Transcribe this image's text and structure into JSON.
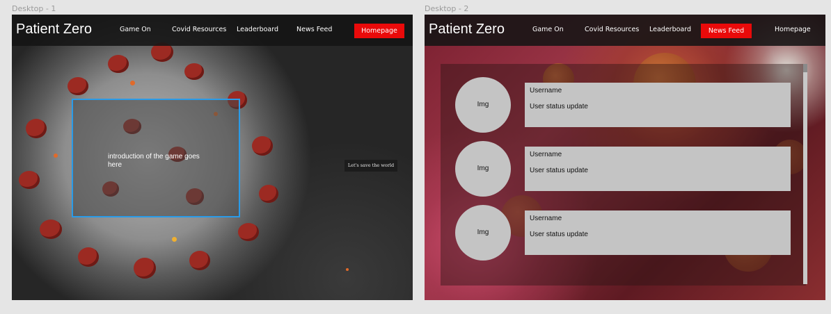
{
  "frames": [
    {
      "label": "Desktop - 1",
      "brand": "Patient Zero",
      "nav": [
        "Game On",
        "Covid Resources",
        "Leaderboard",
        "News Feed",
        "Homepage"
      ],
      "active_nav": "Homepage",
      "intro_text": "introduction of the game goes here",
      "cta_label": "Let's save the world"
    },
    {
      "label": "Desktop - 2",
      "brand": "Patient Zero",
      "nav": [
        "Game On",
        "Covid Resources",
        "Leaderboard",
        "News Feed",
        "Homepage"
      ],
      "active_nav": "News Feed",
      "feed": [
        {
          "avatar": "Img",
          "username": "Username",
          "status": "User status update"
        },
        {
          "avatar": "Img",
          "username": "Username",
          "status": "User status update"
        },
        {
          "avatar": "Img",
          "username": "Username",
          "status": "User status update"
        }
      ]
    }
  ],
  "colors": {
    "accent_red": "#ea0a0a",
    "selection_blue": "#2a9be8",
    "card_gray": "#c4c4c4"
  }
}
